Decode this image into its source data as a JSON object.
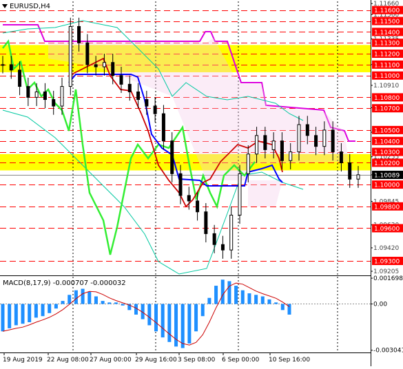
{
  "header": {
    "symbol_label": "EURUSD,H4"
  },
  "macd": {
    "label": "MACD(8,17,9) -0.000707 -0.000032"
  },
  "colors": {
    "price_line_red": "#ff0000",
    "price_label_red": "#ff0000",
    "current_price": "#000000",
    "yellow_zone": "#ffff00",
    "candles": "#000000",
    "kijun_blue": "#0000ff",
    "tenkan_red": "#cc0000",
    "chikou_green": "#33ee33",
    "cloud_magenta": "#dd00dd",
    "bollinger_cyan": "#00c8a0",
    "macd_hist": "#1e8fff",
    "macd_signal": "#cc0000"
  },
  "chart_data": [
    {
      "type": "line",
      "name": "EURUSD H4 price",
      "x_labels": [
        "19 Aug 2019",
        "22 Aug 08:00",
        "27 Aug 00:00",
        "29 Aug 16:00",
        "3 Sep 08:00",
        "6 Sep 00:00",
        "10 Sep 16:00"
      ],
      "ylim": [
        1.0918,
        1.1168
      ],
      "price_tick_labels": [
        "1.11660",
        "1.11560",
        "1.11335",
        "1.11100",
        "1.10910",
        "1.10705",
        "1.10480",
        "1.10255",
        "1.10089",
        "1.09845",
        "1.09630",
        "1.09420",
        "1.09205"
      ],
      "levels": [
        {
          "label": "1.11600",
          "value": 1.116
        },
        {
          "label": "1.11500",
          "value": 1.115
        },
        {
          "label": "1.11400",
          "value": 1.114
        },
        {
          "label": "1.11300",
          "value": 1.113
        },
        {
          "label": "1.11200",
          "value": 1.112
        },
        {
          "label": "1.11100",
          "value": 1.111
        },
        {
          "label": "1.11000",
          "value": 1.11
        },
        {
          "label": "1.10800",
          "value": 1.108
        },
        {
          "label": "1.10700",
          "value": 1.107
        },
        {
          "label": "1.10500",
          "value": 1.105
        },
        {
          "label": "1.10400",
          "value": 1.104
        },
        {
          "label": "1.10300",
          "value": 1.103
        },
        {
          "label": "1.10200",
          "value": 1.102
        },
        {
          "label": "1.10000",
          "value": 1.1
        },
        {
          "label": "1.09800",
          "value": 1.098
        },
        {
          "label": "1.09600",
          "value": 1.096
        },
        {
          "label": "1.09300",
          "value": 1.093
        }
      ],
      "current_price": {
        "label": "1.10089",
        "value": 1.10089
      },
      "zones": [
        {
          "from": 1.1103,
          "to": 1.1128
        },
        {
          "from": 1.1013,
          "to": 1.1028
        }
      ],
      "series": [
        {
          "name": "",
          "values": [
            1.111,
            1.1105,
            1.109,
            1.108,
            1.1085,
            1.1078,
            1.1072,
            1.109,
            1.1145,
            1.113,
            1.111,
            1.1108,
            1.1112,
            1.11,
            1.1092,
            1.1085,
            1.1078,
            1.1072,
            1.1065,
            1.104,
            1.101,
            1.099,
            1.0985,
            1.0975,
            1.0955,
            1.0945,
            1.094,
            1.0972,
            1.101,
            1.1028,
            1.1045,
            1.1032,
            1.104,
            1.1022,
            1.103,
            1.1055,
            1.1045,
            1.1035,
            1.105,
            1.103,
            1.102,
            1.1005,
            1.1009
          ]
        }
      ]
    },
    {
      "type": "bar",
      "name": "MACD histogram",
      "label": "MACD(8,17,9) -0.000707 -0.000032",
      "ylim": [
        -0.0031,
        0.0017
      ],
      "tick_labels": [
        "0.001698",
        "0.00",
        "-0.003041"
      ],
      "series": [
        {
          "name": "",
          "values": [
            -0.0018,
            -0.0016,
            -0.0014,
            -0.0013,
            -0.0012,
            -0.0009,
            -0.0008,
            -0.0006,
            -0.0003,
            0.0002,
            0.0006,
            0.0009,
            0.001,
            0.0008,
            0.0005,
            0.0002,
            0.0001,
            0.0001,
            -0.0001,
            -0.0004,
            -0.0007,
            -0.001,
            -0.0014,
            -0.0018,
            -0.0022,
            -0.0025,
            -0.0028,
            -0.0029,
            -0.0026,
            -0.0018,
            -0.0008,
            0.0004,
            0.0012,
            0.0016,
            0.0015,
            0.0012,
            0.0009,
            0.0007,
            0.0006,
            0.0005,
            0.0003,
            0.0001,
            -0.0004,
            -0.0007
          ]
        }
      ]
    }
  ]
}
